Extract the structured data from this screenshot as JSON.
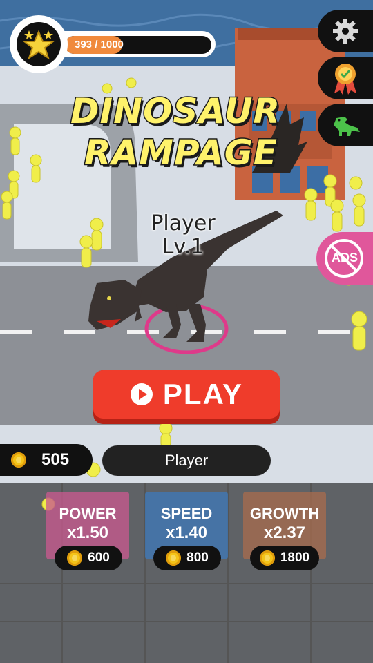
{
  "xp": {
    "text": "393 / 1000",
    "current": 393,
    "max": 1000,
    "fill_color": "#f08a3c"
  },
  "title": {
    "line1": "DINOSAUR",
    "line2": "RAMPAGE"
  },
  "player_tag": {
    "name": "Player",
    "level": "Lv.1"
  },
  "side_buttons": {
    "settings_icon": "gear-icon",
    "rewards_icon": "ribbon-medal-icon",
    "dino_icon": "dinosaur-icon",
    "no_ads_label": "ADS"
  },
  "play": {
    "label": "PLAY",
    "color": "#ef3c2b"
  },
  "coins": {
    "amount": "505"
  },
  "player_name": "Player",
  "upgrades": [
    {
      "name": "POWER",
      "multiplier": "x1.50",
      "price": "600",
      "color": "#c65a8e"
    },
    {
      "name": "SPEED",
      "multiplier": "x1.40",
      "price": "800",
      "color": "#3f78b7"
    },
    {
      "name": "GROWTH",
      "multiplier": "x2.37",
      "price": "1800",
      "color": "#a56b4e"
    }
  ]
}
